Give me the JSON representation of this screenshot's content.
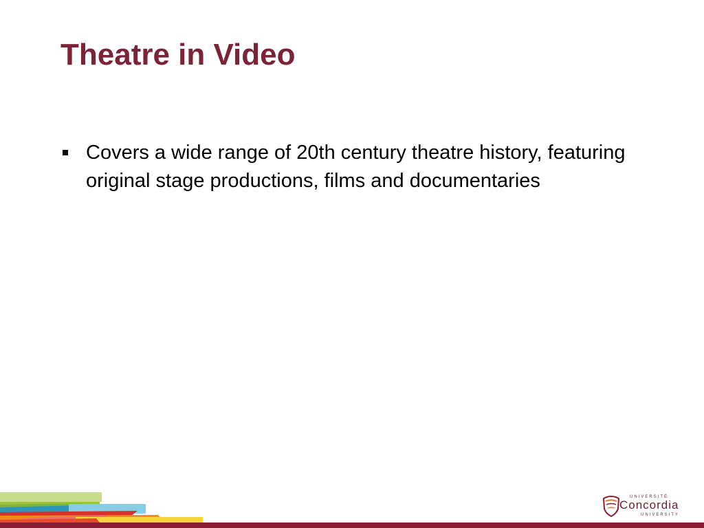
{
  "slide": {
    "title": "Theatre in Video",
    "bullets": [
      "Covers a wide range of 20th century theatre history, featuring original stage productions, films and documentaries"
    ]
  },
  "logo": {
    "top_text": "UNIVERSITÉ",
    "name": "Concordia",
    "bottom_text": "UNIVERSITY"
  },
  "colors": {
    "title": "#7b2437",
    "text": "#000000",
    "bottom_bar": "#8a1f33",
    "logo": "#6b1d2e"
  }
}
